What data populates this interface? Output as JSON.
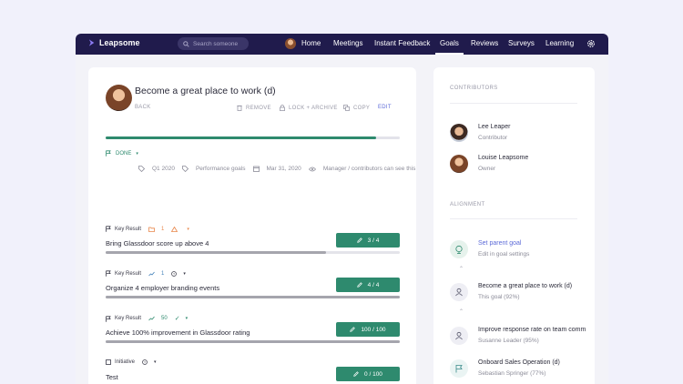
{
  "nav": {
    "brand": "Leapsome",
    "search_placeholder": "Search someone",
    "links": [
      "Home",
      "Meetings",
      "Instant Feedback",
      "Goals",
      "Reviews",
      "Surveys",
      "Learning"
    ],
    "active": "Goals",
    "brand_color": "#201b4c"
  },
  "goal": {
    "title": "Become a great place to work (d)",
    "back": "BACK",
    "actions": {
      "remove": "REMOVE",
      "lock": "LOCK + ARCHIVE",
      "copy": "COPY",
      "edit": "EDIT"
    },
    "progress": 0.92,
    "status": "DONE",
    "meta": {
      "quarter": "Q1 2020",
      "type": "Performance goals",
      "date": "Mar 31, 2020",
      "visibility": "Manager / contributors can see this"
    },
    "accent_color": "#2e8a6e"
  },
  "key_results": [
    {
      "kind": "Key Result",
      "badge": "1",
      "title": "Bring Glassdoor score up above 4",
      "button": "3 / 4",
      "progress": 0.75
    },
    {
      "kind": "Key Result",
      "badge": "1",
      "title": "Organize 4 employer branding events",
      "button": "4 / 4",
      "progress": 1.0
    },
    {
      "kind": "Key Result",
      "badge": "50",
      "title": "Achieve 100% improvement in Glassdoor rating",
      "button": "100 / 100",
      "progress": 1.0
    },
    {
      "kind": "Initiative",
      "badge": "",
      "title": "Test",
      "button": "0 / 100",
      "progress": 0.02
    }
  ],
  "sidebar": {
    "contributors_label": "CONTRIBUTORS",
    "contributors": [
      {
        "name": "Lee Leaper",
        "role": "Contributor"
      },
      {
        "name": "Louise Leapsome",
        "role": "Owner"
      }
    ],
    "alignment_label": "ALIGNMENT",
    "alignment": [
      {
        "title": "Set parent goal",
        "sub": "Edit in goal settings",
        "icon": "globe-icon"
      },
      {
        "title": "Become a great place to work (d)",
        "sub": "This goal (92%)",
        "icon": "person-icon"
      },
      {
        "title": "Improve response rate on team comm",
        "sub": "Susanne Leader (95%)",
        "icon": "person-icon"
      },
      {
        "title": "Onboard Sales Operation (d)",
        "sub": "Sebastian Springer (77%)",
        "icon": "flag-icon"
      }
    ]
  }
}
